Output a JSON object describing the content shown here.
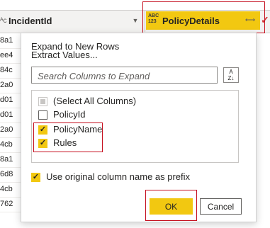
{
  "grid": {
    "type_glyph": "ᴬc",
    "incident_column_label": "IncidentId",
    "policy_column_type": "ABC\n123",
    "policy_column_label": "PolicyDetails",
    "row_values": [
      "8a1",
      "ee4",
      "84c",
      "2a0",
      "d01",
      "d01",
      "2a0",
      "4cb",
      "8a1",
      "6d8",
      "4cb",
      "762"
    ]
  },
  "dialog": {
    "option_expand": "Expand to New Rows",
    "option_extract": "Extract Values...",
    "search_placeholder": "Search Columns to Expand",
    "sort_icon_text": "A\nZ↓",
    "columns": [
      {
        "label": "(Select All Columns)",
        "state": "partial"
      },
      {
        "label": "PolicyId",
        "state": "unchecked"
      },
      {
        "label": "PolicyName",
        "state": "checked"
      },
      {
        "label": "Rules",
        "state": "checked"
      }
    ],
    "prefix_label": "Use original column name as prefix",
    "prefix_checked": true,
    "ok_label": "OK",
    "cancel_label": "Cancel"
  },
  "colors": {
    "accent": "#f2c811",
    "highlight_border": "#c50f1f"
  }
}
